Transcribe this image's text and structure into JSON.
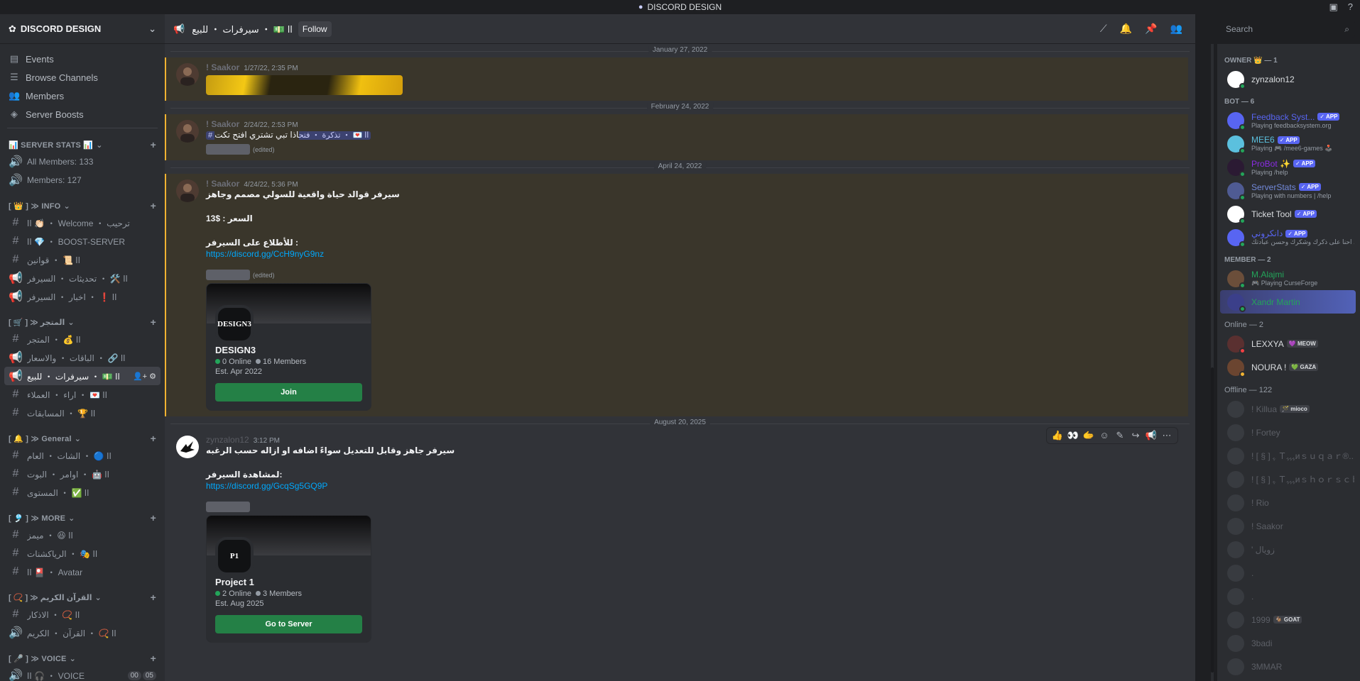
{
  "titlebar": {
    "title": "DISCORD DESIGN"
  },
  "server": {
    "name": "DISCORD DESIGN"
  },
  "nav": [
    {
      "label": "Events",
      "icon": "calendar-icon"
    },
    {
      "label": "Browse Channels",
      "icon": "browse-icon"
    },
    {
      "label": "Members",
      "icon": "members-icon"
    },
    {
      "label": "Server Boosts",
      "icon": "boost-icon"
    }
  ],
  "categories": [
    {
      "label": "📊 SERVER STATS 📊",
      "channels": [
        {
          "name": "All Members: 133",
          "icon": "voice"
        },
        {
          "name": "Members: 127",
          "icon": "voice"
        }
      ]
    },
    {
      "label": "[ 👑 ] ≫ INFO",
      "channels": [
        {
          "name": "اا 👏🏻 ・ Welcome ・ ترحيب",
          "icon": "hash"
        },
        {
          "name": "اا 💎 ・ BOOST-SERVER",
          "icon": "hash"
        },
        {
          "name": "اا 📜 ・ قوانين",
          "icon": "hash"
        },
        {
          "name": "اا 🛠️ ・ تحديثات ・ السيرفر",
          "icon": "announce"
        },
        {
          "name": "اا ❗ ・ اخبار ・ السيرفر",
          "icon": "announce"
        }
      ]
    },
    {
      "label": "[ 🛒 ] ≫ المتجر",
      "channels": [
        {
          "name": "اا 💰 ・ المتجر",
          "icon": "hash"
        },
        {
          "name": "اا 🔗 ・ الباقات ・ والاسعار",
          "icon": "announce"
        },
        {
          "name": "اا 💵 ・ سيرفرات ・ للبيع",
          "icon": "announce"
        },
        {
          "name": "اا 💌 ・ اراء ・ العملاء",
          "icon": "hash"
        },
        {
          "name": "اا 🏆 ・ المسابقات",
          "icon": "hash"
        }
      ]
    },
    {
      "label": "[ 🔔 ] ≫ General",
      "channels": [
        {
          "name": "اا 🔵 ・ الشات ・ العام",
          "icon": "hash"
        },
        {
          "name": "اا 🤖 ・ اوامر ・ البوت",
          "icon": "hash"
        },
        {
          "name": "اا ✅ ・ المستوى",
          "icon": "hash"
        }
      ]
    },
    {
      "label": "[ 🎐 ] ≫ MORE",
      "channels": [
        {
          "name": "اا 😆 ・ ميمز",
          "icon": "hash"
        },
        {
          "name": "اا 🎭 ・ الرياكشنات",
          "icon": "hash"
        },
        {
          "name": "اا 🎴 ・ Avatar",
          "icon": "hash"
        }
      ]
    },
    {
      "label": "[ 📿 ] ≫ القرآن الكريم",
      "channels": [
        {
          "name": "اا 📿 ・ الاذكار",
          "icon": "hash"
        },
        {
          "name": "اا 📿 ・ القرآن ・ الكريم",
          "icon": "voice"
        }
      ]
    },
    {
      "label": "[ 🎤 ] ≫ VOICE",
      "channels": [
        {
          "name": "اا 🎧 ・ VOICE",
          "icon": "voice",
          "badges": [
            "00",
            "05"
          ]
        }
      ]
    }
  ],
  "topbar": {
    "channel": "اا 💵 ・ سيرفرات ・ للبيع",
    "follow": "Follow",
    "search_placeholder": "Search"
  },
  "messages": [
    {
      "date": "January 27, 2022",
      "author": "! Saakor",
      "time": "1/27/22, 2:35 PM"
    },
    {
      "date": "February 24, 2022",
      "author": "! Saakor",
      "time": "2/24/22, 2:53 PM",
      "text": "اذا تبي تشتري افتح تكت",
      "mention": "# اا 💌 ・ تذكرة ・ فتح",
      "edited": "(edited)"
    },
    {
      "date": "April 24, 2022",
      "author": "! Saakor",
      "time": "4/24/22, 5:36 PM",
      "lines": [
        "سيرفر قوالد حياة واقعية للسولي مصمم وجاهز",
        "",
        "السعر : $13",
        "",
        "للأطلاع على السيرفر :"
      ],
      "link": "https://discord.gg/CcH9nyG9nz",
      "edited": "(edited)",
      "invite": {
        "icon": "DESIGN3",
        "name": "DESIGN3",
        "online": "0 Online",
        "members": "16 Members",
        "est": "Est. Apr 2022",
        "button": "Join"
      }
    },
    {
      "date": "August 20, 2025",
      "author": "zynzalon12",
      "time": "3:12 PM",
      "lines": [
        "سيرفر جاهز وقابل للتعديل سواءً اضافه او ازاله حسب الرغبه",
        "",
        "لمشاهدة السيرفر:"
      ],
      "link": "https://discord.gg/GcqSg5GQ9P",
      "invite": {
        "icon": "P1",
        "name": "Project 1",
        "online": "2 Online",
        "members": "3 Members",
        "est": "Est. Aug 2025",
        "button": "Go to Server"
      },
      "actions": [
        "👍",
        "👀",
        "🫱"
      ]
    }
  ],
  "member_groups": {
    "owner": "OWNER 👑 — 1",
    "bot": "BOT — 6",
    "member": "MEMBER — 2",
    "online": "Online — 2",
    "offline": "Offline — 122"
  },
  "members": {
    "owner": [
      {
        "name": "zynzalon12",
        "status": "#23a55a"
      }
    ],
    "bots": [
      {
        "name": "Feedback Syst...",
        "activity": "Playing feedbacksystem.org",
        "tag": "✓ APP",
        "color": "#5865f2"
      },
      {
        "name": "MEE6",
        "activity": "Playing 🎮 /mee6-games 🕹️",
        "tag": "✓ APP",
        "color": "#5bc0de"
      },
      {
        "name": "ProBot ✨",
        "activity": "Playing /help",
        "tag": "✓ APP",
        "color": "#8a2be2"
      },
      {
        "name": "ServerStats",
        "activity": "Playing with numbers | /help",
        "tag": "✓ APP",
        "color": "#7289da"
      },
      {
        "name": "Ticket Tool",
        "activity": "",
        "tag": "✓ APP",
        "color": "#dbdee1"
      },
      {
        "name": "دانكروني",
        "activity": "احنا على ذكرك وشكرك وحسن عبادتك ...",
        "tag": "✓ APP",
        "color": "#5865f2"
      }
    ],
    "members": [
      {
        "name": "M.Alajmi",
        "activity": "🎮 Playing CurseForge",
        "color": "#23a55a"
      },
      {
        "name": "Xandr Martin",
        "activity": "",
        "color": "#23a55a"
      }
    ],
    "online": [
      {
        "name": "LEXXYA",
        "tag": "💜 MEOW",
        "status": "#f23f43"
      },
      {
        "name": "NOURA !",
        "tag": "💚 GAZA",
        "status": "#f0b232"
      }
    ],
    "offline": [
      {
        "name": "! Killua",
        "tag": "🪄 mioco"
      },
      {
        "name": "! Fortey",
        "tag": ""
      },
      {
        "name": "! [ § ] ﮩ Ｔﮩﮩﮩᴎｓｕｑａｒ®...",
        "tag": ""
      },
      {
        "name": "! [ § ] ﮩ Ｔﮩﮩﮩᴎｓｈｏｒｓｃｂ...",
        "tag": ""
      },
      {
        "name": "! Rio",
        "tag": ""
      },
      {
        "name": "! Saakor",
        "tag": ""
      },
      {
        "name": "' زويال",
        "tag": ""
      },
      {
        "name": ".",
        "tag": ""
      },
      {
        "name": ".",
        "tag": ""
      },
      {
        "name": "1999",
        "tag": "🐐 GOAT"
      },
      {
        "name": "3badi",
        "tag": ""
      },
      {
        "name": "3MMAR",
        "tag": ""
      }
    ]
  }
}
